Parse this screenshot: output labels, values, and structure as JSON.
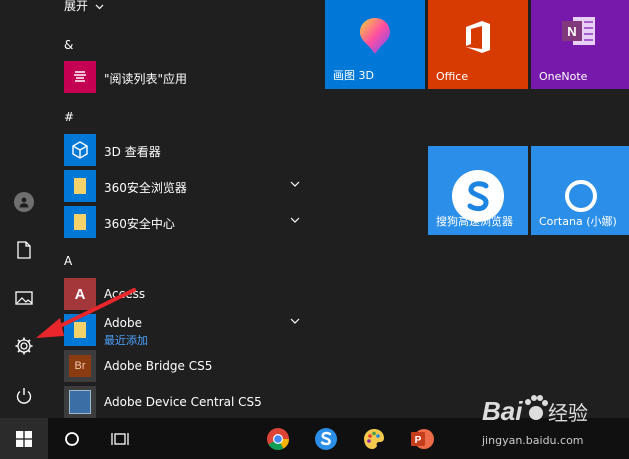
{
  "applist": {
    "expand_label": "展开",
    "groups": [
      {
        "letter": "&"
      },
      {
        "letter": "#"
      },
      {
        "letter": "A"
      }
    ],
    "items": [
      {
        "label": "\"阅读列表\"应用"
      },
      {
        "label": "3D 查看器"
      },
      {
        "label": "360安全浏览器"
      },
      {
        "label": "360安全中心"
      },
      {
        "label": "Access"
      },
      {
        "label": "Adobe",
        "sub": "最近添加"
      },
      {
        "label": "Adobe Bridge CS5"
      },
      {
        "label": "Adobe Device Central CS5"
      }
    ]
  },
  "tiles": [
    {
      "label": "画图 3D",
      "color": "#0078d7"
    },
    {
      "label": "Office",
      "color": "#d83b01"
    },
    {
      "label": "OneNote",
      "color": "#7719aa"
    },
    {
      "label": "搜狗高速浏览器",
      "color": "#2b8ee8"
    },
    {
      "label": "Cortana (小娜)",
      "color": "#2b8ee8"
    }
  ],
  "colors": {
    "accent": "#0078d7",
    "arrow": "#e8262b",
    "folder": "#f2d26b",
    "reading_list": "#c30052",
    "access": "#a4373a",
    "bridge": "#8a3b12",
    "device_central": "#3a6ea5"
  },
  "icons": [
    "user-icon",
    "document-icon",
    "pictures-icon",
    "settings-icon",
    "power-icon",
    "windows-icon",
    "cortana-icon",
    "task-view-icon",
    "chrome-icon",
    "sogou-icon",
    "paint-icon",
    "powerpoint-icon"
  ],
  "watermark": {
    "text": "jingyan.baidu.com",
    "logo_text": "Bai",
    "logo_text2": "经验"
  }
}
